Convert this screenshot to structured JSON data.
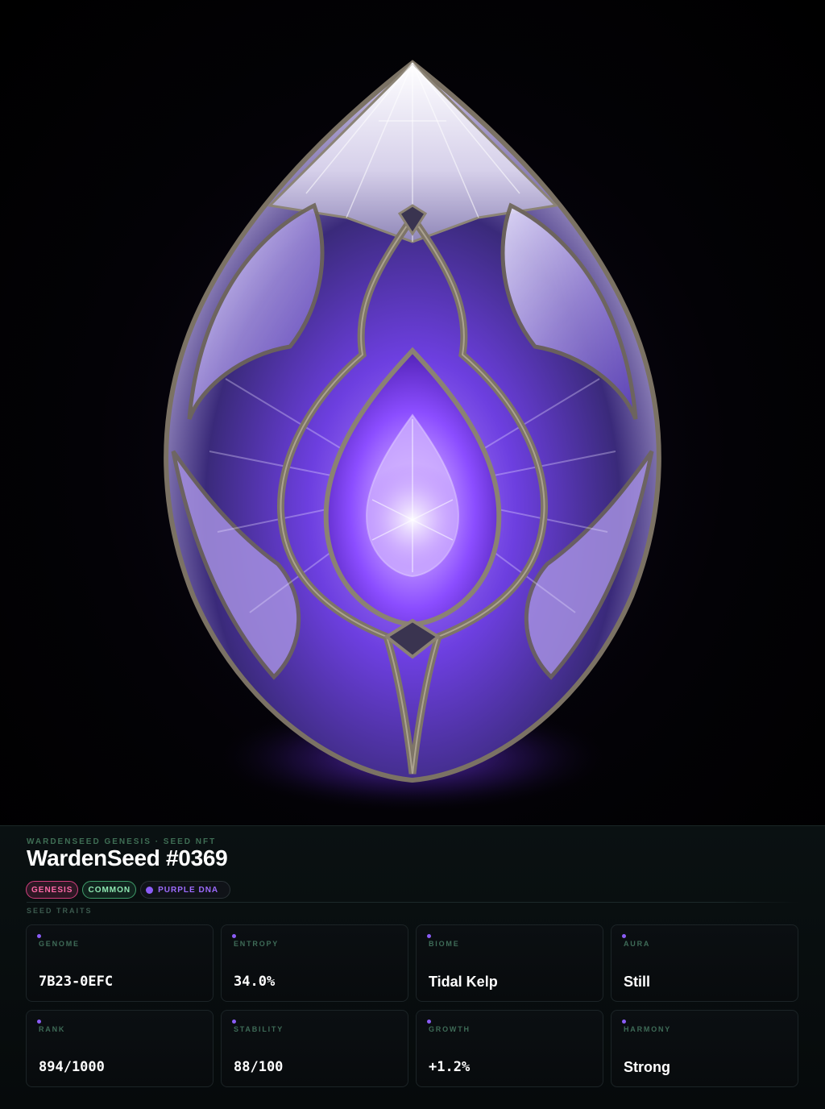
{
  "artwork": {
    "subject": "seed-crystal",
    "colors": {
      "core": "#9b5cff",
      "glow": "#7b3cff",
      "filigree": "#6b6258",
      "crystal": "#d9d2f2"
    }
  },
  "header": {
    "eyebrow": "WARDENSEED GENESIS · SEED NFT",
    "title": "WardenSeed #0369"
  },
  "badges": {
    "genesis": "GENESIS",
    "rarity": "COMMON",
    "dna": "PURPLE DNA",
    "dna_color": "#8b5cf6"
  },
  "traits_label": "SEED TRAITS",
  "traits": [
    {
      "label": "GENOME",
      "value": "7B23-0EFC"
    },
    {
      "label": "ENTROPY",
      "value": "34.0%"
    },
    {
      "label": "BIOME",
      "value": "Tidal Kelp"
    },
    {
      "label": "AURA",
      "value": "Still"
    },
    {
      "label": "RANK",
      "value": "894/1000"
    },
    {
      "label": "STABILITY",
      "value": "88/100"
    },
    {
      "label": "GROWTH",
      "value": "+1.2%"
    },
    {
      "label": "HARMONY",
      "value": "Strong"
    }
  ]
}
